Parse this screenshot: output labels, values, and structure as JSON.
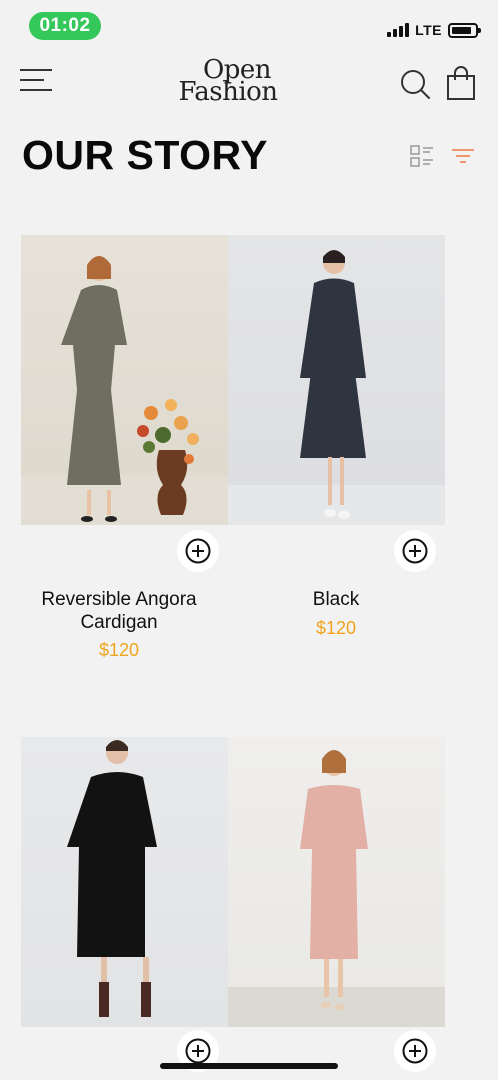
{
  "status_bar": {
    "time": "01:02",
    "network": "LTE"
  },
  "header": {
    "logo_line1": "Open",
    "logo_line2": "Fashion",
    "menu_icon": "hamburger-menu-icon",
    "search_icon": "search-icon",
    "bag_icon": "shopping-bag-icon"
  },
  "page": {
    "title": "OUR STORY",
    "view_icon": "list-view-icon",
    "filter_icon": "filter-icon",
    "accent_color": "#f0a41e",
    "filter_color": "#f08a5d"
  },
  "products": [
    {
      "name": "Reversible Angora Cardigan",
      "price": "$120",
      "image": "model in grey plaid belted coat dress beside flower vase"
    },
    {
      "name": "Black",
      "price": "$120",
      "image": "model in dark navy belted coat dress"
    },
    {
      "name": "",
      "price": "",
      "image": "model in black long-sleeve keyhole dress"
    },
    {
      "name": "",
      "price": "",
      "image": "model in pink square-neck midi dress"
    }
  ]
}
